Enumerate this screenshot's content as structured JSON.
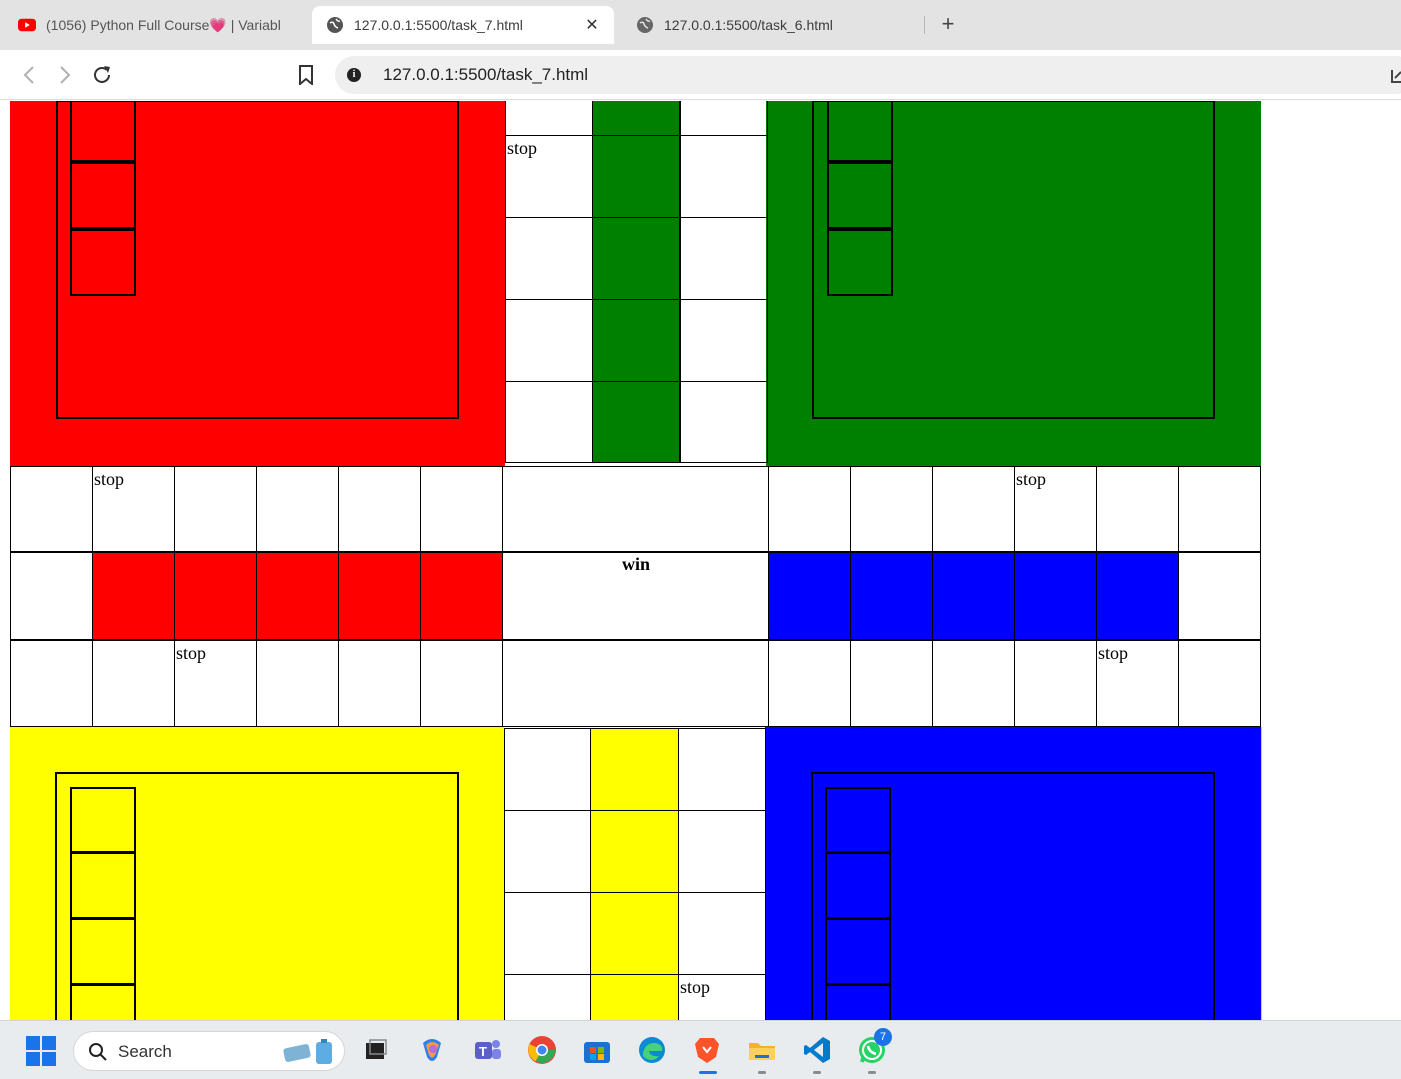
{
  "browser": {
    "tabs": [
      {
        "title": "(1056) Python Full Course💗 | Variabl",
        "favicon": "youtube-icon",
        "active": false
      },
      {
        "title": "127.0.0.1:5500/task_7.html",
        "favicon": "globe-icon",
        "active": true
      },
      {
        "title": "127.0.0.1:5500/task_6.html",
        "favicon": "globe-icon",
        "active": false
      }
    ],
    "close_glyph": "✕",
    "new_tab_glyph": "+",
    "address": "127.0.0.1:5500/task_7.html",
    "info_glyph": "i"
  },
  "board": {
    "colors": {
      "red": "#ff0000",
      "green": "#008000",
      "yellow": "#ffff00",
      "blue": "#0000ff",
      "white": "#ffffff",
      "border": "#000000"
    },
    "stop_label": "stop",
    "win_label": "win"
  },
  "taskbar": {
    "search_placeholder": "Search",
    "whatsapp_badge": "7"
  }
}
